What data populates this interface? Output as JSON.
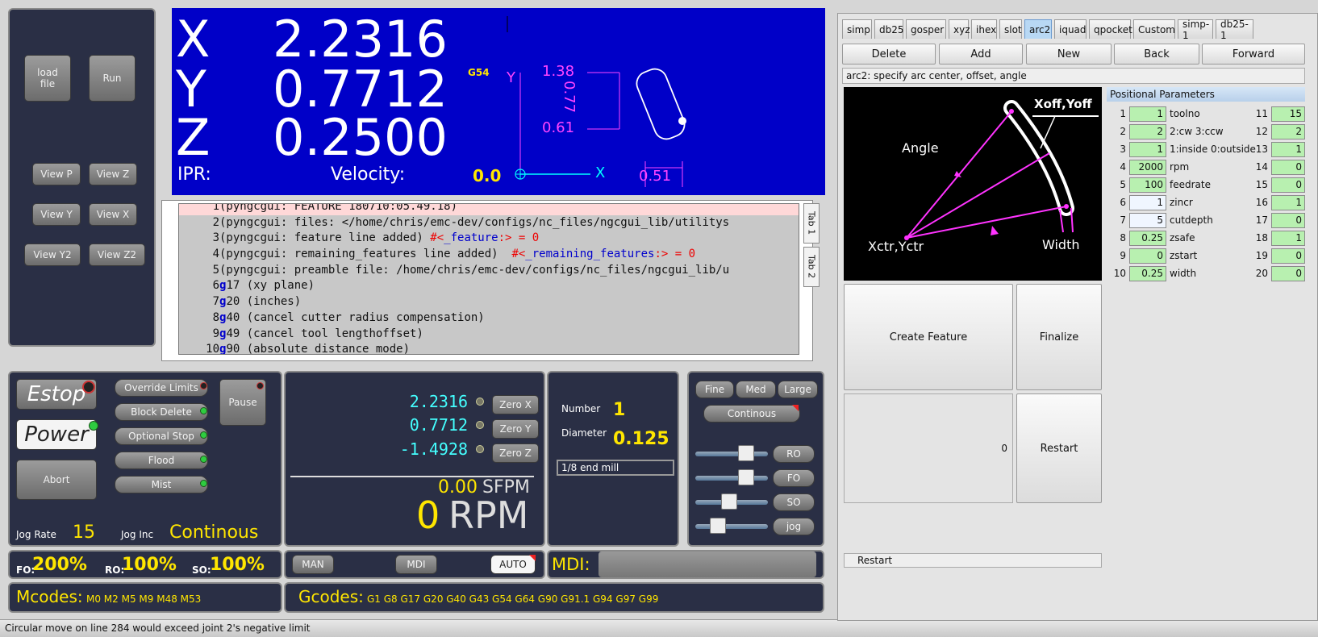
{
  "left_buttons": {
    "load": "load\nfile",
    "run": "Run",
    "view_p": "View P",
    "view_z": "View Z",
    "view_y": "View Y",
    "view_x": "View X",
    "view_y2": "View Y2",
    "view_z2": "View Z2"
  },
  "dro": {
    "x_label": "X",
    "x_value": "2.2316",
    "y_label": "Y",
    "y_value": "0.7712",
    "z_label": "Z",
    "z_value": "0.2500",
    "ipr_label": "IPR:",
    "velocity_label": "Velocity:",
    "velocity_value": "0.0",
    "coord_system": "G54"
  },
  "preview": {
    "y_axis": "Y",
    "x_axis": "X",
    "dim1": "1.38",
    "dim2": "0.77",
    "dim3": "0.61",
    "dim4": "0.51"
  },
  "gcode_lines": [
    {
      "n": "1",
      "code": "(pyngcgui: FEATURE 180710:05.49.18)"
    },
    {
      "n": "2",
      "code": "(pyngcgui: files: </home/chris/emc-dev/configs/nc_files/ngcgui_lib/utilitys"
    },
    {
      "n": "3",
      "pre": "(pyngcgui: feature line added) ",
      "hash": "#<",
      "var": "_feature",
      "post": ":> = 0"
    },
    {
      "n": "4",
      "pre": "(pyngcgui: remaining_features line added)  ",
      "hash": "#<",
      "var": "_remaining_features",
      "post": ":> = 0"
    },
    {
      "n": "5",
      "code": "(pyngcgui: preamble file: /home/chris/emc-dev/configs/nc_files/ngcgui_lib/u"
    },
    {
      "n": "6",
      "g": "g",
      "rest": "17 (xy plane)"
    },
    {
      "n": "7",
      "g": "g",
      "rest": "20 (inches)"
    },
    {
      "n": "8",
      "g": "g",
      "rest": "40 (cancel cutter radius compensation)"
    },
    {
      "n": "9",
      "g": "g",
      "rest": "49 (cancel tool lengthoffset)"
    },
    {
      "n": "10",
      "g": "g",
      "rest": "90 (absolute distance mode)"
    }
  ],
  "side_tabs": {
    "tab1": "Tab 1",
    "tab2": "Tab 2"
  },
  "controls": {
    "estop": "Estop",
    "power": "Power",
    "abort": "Abort",
    "override_limits": "Override Limits",
    "block_delete": "Block Delete",
    "optional_stop": "Optional Stop",
    "flood": "Flood",
    "mist": "Mist",
    "pause": "Pause",
    "jog_rate_label": "Jog Rate",
    "jog_rate": "15",
    "jog_inc_label": "Jog Inc",
    "jog_inc": "Continous"
  },
  "rel_dro": {
    "x": "2.2316",
    "y": "0.7712",
    "z": "-1.4928",
    "zero_x": "Zero X",
    "zero_y": "Zero Y",
    "zero_z": "Zero Z",
    "sfpm_value": "0.00",
    "sfpm_label": "SFPM",
    "rpm_value": "0",
    "rpm_label": "RPM"
  },
  "tool": {
    "number_label": "Number",
    "number": "1",
    "diameter_label": "Diameter",
    "diameter": "0.125",
    "description": "1/8 end mill"
  },
  "jog": {
    "fine": "Fine",
    "med": "Med",
    "large": "Large",
    "continous": "Continous",
    "ro": "RO",
    "fo": "FO",
    "so": "SO",
    "jog": "jog",
    "ro_level": 0.75,
    "fo_level": 0.75,
    "so_level": 0.45,
    "jog_level": 0.25
  },
  "overrides": {
    "fo_label": "FO:",
    "fo": "200%",
    "ro_label": "RO:",
    "ro": "100%",
    "so_label": "SO:",
    "so": "100%"
  },
  "modes": {
    "man": "MAN",
    "mdi": "MDI",
    "auto": "AUTO",
    "mdi_label": "MDI:"
  },
  "mcodes": {
    "label": "Mcodes:",
    "value": "M0 M2 M5 M9 M48 M53"
  },
  "gcodes": {
    "label": "Gcodes:",
    "value": "G1 G8 G17 G20 G40 G43 G54 G64 G90 G91.1 G94 G97 G99"
  },
  "status": "Circular move on line 284 would exceed joint 2's negative limit",
  "ngcgui": {
    "tabs": [
      "simp",
      "db25",
      "gosper",
      "xyz",
      "ihex",
      "slot",
      "arc2",
      "iquad",
      "qpocket",
      "Custom",
      "simp-1",
      "db25-1"
    ],
    "active_tab": "arc2",
    "buttons": {
      "delete": "Delete",
      "add": "Add",
      "new": "New",
      "back": "Back",
      "forward": "Forward"
    },
    "info": "arc2: specify arc center, offset, angle",
    "diagram": {
      "xoff": "Xoff,Yoff",
      "angle": "Angle",
      "xctr": "Xctr,Yctr",
      "width": "Width"
    },
    "create_feature": "Create Feature",
    "finalize": "Finalize",
    "counter": "0",
    "restart": "Restart",
    "restart_bar": "Restart",
    "params_title": "Positional Parameters",
    "params_left": [
      {
        "n": "1",
        "v": "1",
        "name": "toolno"
      },
      {
        "n": "2",
        "v": "2",
        "name": "2:cw 3:ccw"
      },
      {
        "n": "3",
        "v": "1",
        "name": "1:inside 0:outside"
      },
      {
        "n": "4",
        "v": "2000",
        "name": "rpm"
      },
      {
        "n": "5",
        "v": "100",
        "name": "feedrate"
      },
      {
        "n": "6",
        "v": "1",
        "name": "zincr"
      },
      {
        "n": "7",
        "v": "5",
        "name": "cutdepth"
      },
      {
        "n": "8",
        "v": "0.25",
        "name": "zsafe"
      },
      {
        "n": "9",
        "v": "0",
        "name": "zstart"
      },
      {
        "n": "10",
        "v": "0.25",
        "name": "width"
      }
    ],
    "params_right": [
      {
        "n": "11",
        "v": "15"
      },
      {
        "n": "12",
        "v": "2"
      },
      {
        "n": "13",
        "v": "1"
      },
      {
        "n": "14",
        "v": "0"
      },
      {
        "n": "15",
        "v": "0"
      },
      {
        "n": "16",
        "v": "1"
      },
      {
        "n": "17",
        "v": "0"
      },
      {
        "n": "18",
        "v": "1"
      },
      {
        "n": "19",
        "v": "0"
      },
      {
        "n": "20",
        "v": "0"
      }
    ]
  }
}
